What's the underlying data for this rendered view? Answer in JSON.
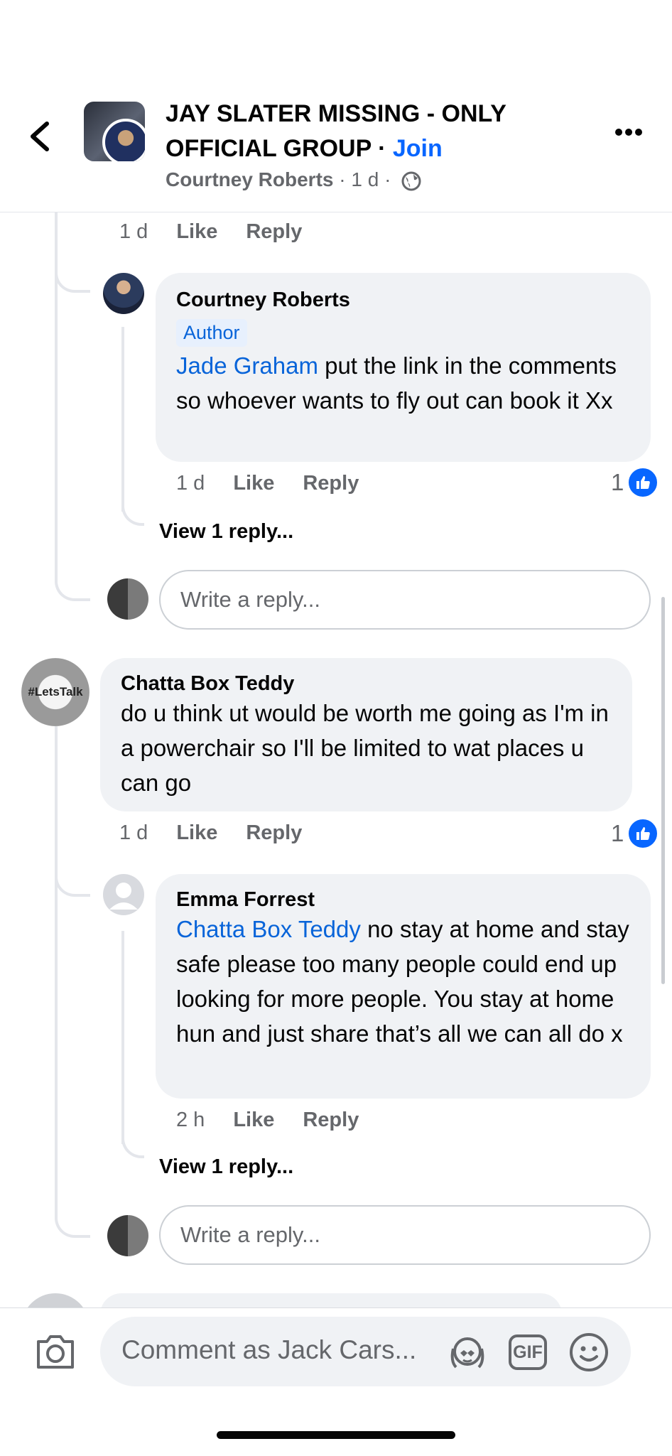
{
  "header": {
    "title_main": "JAY SLATER MISSING - ONLY OFFICIAL GROUP",
    "title_sep": " · ",
    "join_label": "Join",
    "author": "Courtney Roberts",
    "time": "1 d",
    "back_icon": "chevron-left-icon",
    "more_icon": "more-horizontal-icon",
    "privacy_icon": "globe-icon"
  },
  "comments": [
    {
      "meta": {
        "time": "1 d",
        "like": "Like",
        "reply": "Reply"
      }
    },
    {
      "name": "Courtney Roberts",
      "badge": "Author",
      "mention": "Jade Graham",
      "text": " put the link in the comments so whoever wants to fly out can book it Xx",
      "meta": {
        "time": "1 d",
        "like": "Like",
        "reply": "Reply"
      },
      "reactions": "1",
      "view_replies": "View 1 reply..."
    },
    {
      "reply_placeholder": "Write a reply..."
    },
    {
      "name": "Chatta Box Teddy",
      "avatar_text": "#LetsTalk",
      "text": "do u think ut would be worth me going as I'm in a powerchair so I'll be limited to wat places u can go",
      "meta": {
        "time": "1 d",
        "like": "Like",
        "reply": "Reply"
      },
      "reactions": "1"
    },
    {
      "name": "Emma Forrest",
      "mention": "Chatta Box Teddy",
      "text": " no stay at home and stay safe please too many people could end up looking for more people. You stay at home hun and just share that’s all we can all do x",
      "meta": {
        "time": "2 h",
        "like": "Like",
        "reply": "Reply"
      },
      "view_replies": "View 1 reply..."
    },
    {
      "reply_placeholder": "Write a reply..."
    }
  ],
  "composer": {
    "placeholder": "Comment as Jack Cars...",
    "camera_icon": "camera-icon",
    "avatar_sticker_icon": "avatar-sticker-icon",
    "gif_label": "GIF",
    "emoji_icon": "emoji-icon"
  },
  "colors": {
    "accent": "#0866ff",
    "mention": "#0864d9",
    "bubble": "#f0f2f5",
    "secondary_text": "#65676b"
  }
}
